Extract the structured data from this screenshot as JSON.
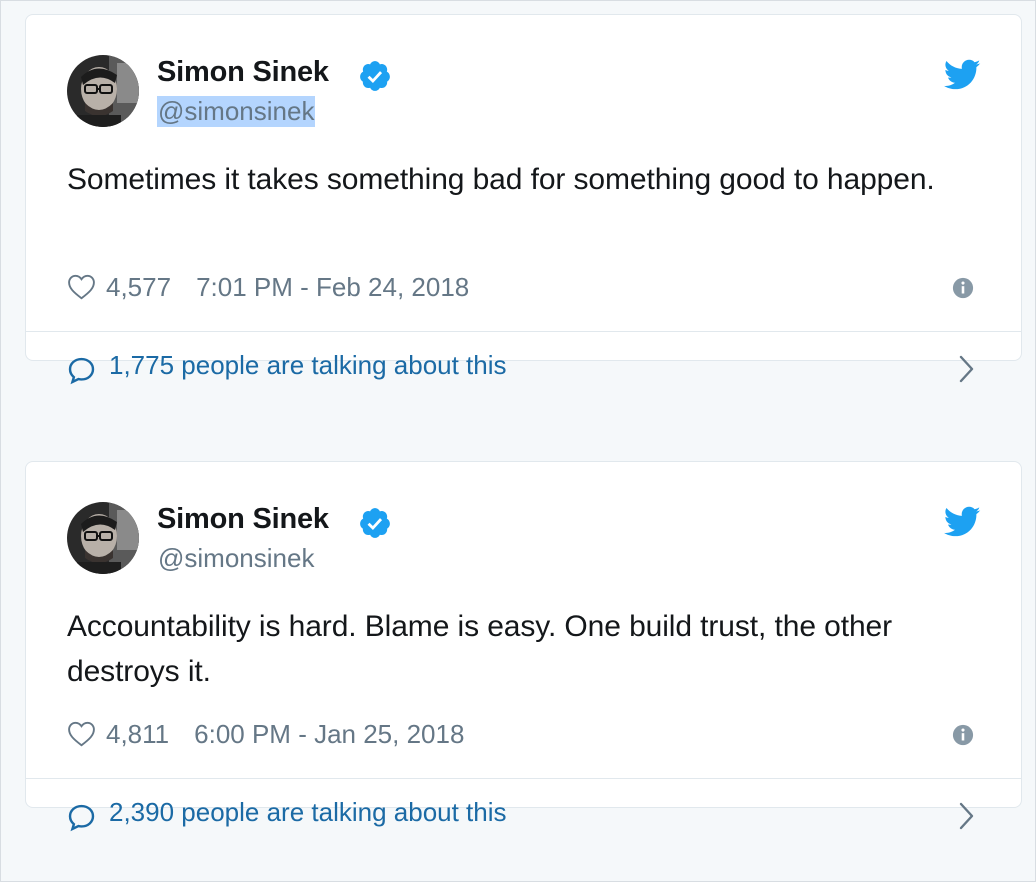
{
  "colors": {
    "background": "#f5f8fa",
    "card_border": "#e1e8ed",
    "name_text": "#14171a",
    "secondary_text": "#657786",
    "link_blue": "#1b6aa5",
    "twitter_blue": "#1da1f2",
    "verified_blue": "#1da1f2",
    "selection_highlight": "#b4d5fe"
  },
  "tweets": [
    {
      "author": {
        "name": "Simon Sinek",
        "handle": "@simonsinek",
        "verified": true,
        "avatar_icon": "avatar-photo"
      },
      "text": "Sometimes it takes something bad for something good to happen.",
      "likes": "4,577",
      "timestamp": "7:01 PM - Feb 24, 2018",
      "conversation": "1,775 people are talking about this",
      "handle_selected": true,
      "icons": [
        "verified-badge-icon",
        "twitter-bird-icon",
        "heart-icon",
        "info-icon",
        "reply-bubble-icon",
        "chevron-right-icon"
      ]
    },
    {
      "author": {
        "name": "Simon Sinek",
        "handle": "@simonsinek",
        "verified": true,
        "avatar_icon": "avatar-photo"
      },
      "text": "Accountability is hard. Blame is easy. One build trust, the other destroys it.",
      "likes": "4,811",
      "timestamp": "6:00 PM - Jan 25, 2018",
      "conversation": "2,390 people are talking about this",
      "handle_selected": false,
      "icons": [
        "verified-badge-icon",
        "twitter-bird-icon",
        "heart-icon",
        "info-icon",
        "reply-bubble-icon",
        "chevron-right-icon"
      ]
    }
  ]
}
